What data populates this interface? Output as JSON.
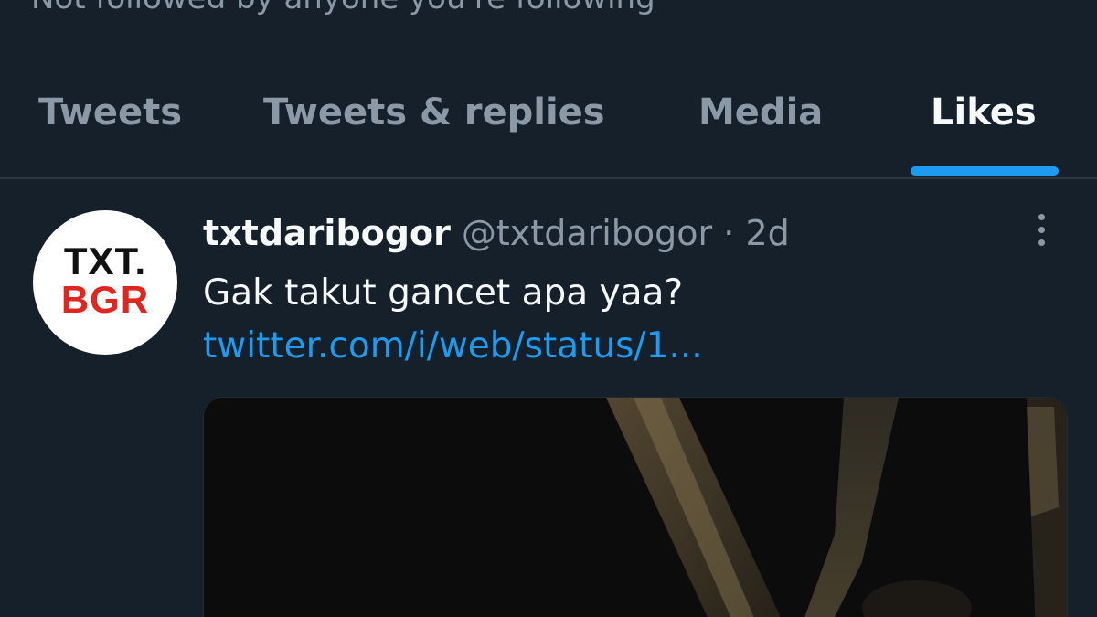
{
  "profile": {
    "followed_note": "Not followed by anyone you're following"
  },
  "tabs": [
    {
      "label": "Tweets",
      "active": false
    },
    {
      "label": "Tweets & replies",
      "active": false
    },
    {
      "label": "Media",
      "active": false
    },
    {
      "label": "Likes",
      "active": true
    }
  ],
  "colors": {
    "background": "#15202b",
    "accent": "#1d9bf0",
    "secondary_text": "#8b98a5",
    "primary_text": "#f7f9f9",
    "logo_red": "#e0261e"
  },
  "tweet": {
    "avatar": {
      "logo_line1": "TXT.",
      "logo_line2": "BGR"
    },
    "author_name": "txtdaribogor",
    "author_handle": "@txtdaribogor",
    "separator": "·",
    "time": "2d",
    "text": "Gak takut gancet apa yaa?",
    "link": "twitter.com/i/web/status/1...",
    "more_icon": "more-vertical-icon"
  }
}
